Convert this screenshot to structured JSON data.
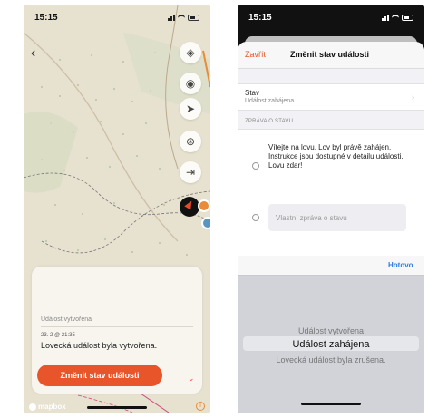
{
  "status_bar": {
    "time": "15:15"
  },
  "left_screen": {
    "event_card": {
      "status": "Událost vytvořena",
      "timestamp": "23. 2 @ 21:35",
      "message": "Lovecká událost byla vytvořena.",
      "change_button": "Změnit stav události"
    },
    "map_attribution": "mapbox"
  },
  "right_screen": {
    "nav": {
      "close": "Zavřít",
      "title": "Změnit stav události"
    },
    "state": {
      "label": "Stav",
      "value": "Událost zahájena"
    },
    "section_header": "ZPRÁVA O STAVU",
    "message_option": "Vítejte na lovu. Lov byl právě zahájen. Instrukce jsou dostupné v detailu události. Lovu zdar!",
    "custom_message_placeholder": "Vlastní zpráva o stavu",
    "picker": {
      "done": "Hotovo",
      "options": [
        "Událost vytvořena",
        "Událost zahájena",
        "Lovecká událost byla zrušena."
      ],
      "selected": "Událost zahájena"
    }
  },
  "colors": {
    "accent": "#e8552b",
    "done_blue": "#2f7ae5",
    "map_bg": "#e7e1d0"
  }
}
